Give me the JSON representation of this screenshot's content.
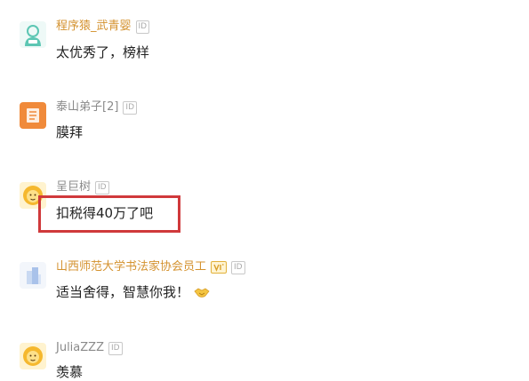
{
  "comments": [
    {
      "username": "程序猿_武青婴",
      "id_badge": "ID",
      "text": "太优秀了，榜样",
      "name_color": "#d4922f",
      "avatar_icon": "robot-icon",
      "avatar_color": "#5cc6b3"
    },
    {
      "username": "泰山弟子[2]",
      "id_badge": "ID",
      "text": "膜拜",
      "name_color": "#8a8a8a",
      "avatar_icon": "book-icon",
      "avatar_color": "#f08a3a"
    },
    {
      "username": "呈巨树",
      "id_badge": "ID",
      "text": "扣税得40万了吧",
      "name_color": "#8a8a8a",
      "avatar_icon": "lion-icon",
      "avatar_color": "#f5c23a"
    },
    {
      "username": "山西师范大学书法家协会员工",
      "id_badge": "ID",
      "text": "适当舍得，智慧你我！",
      "name_color": "#d4922f",
      "avatar_icon": "building-icon",
      "avatar_color": "#c9d9f2",
      "vip_badge": "vip-icon",
      "emoji": "handshake-icon"
    },
    {
      "username": "JuliaZZZ",
      "id_badge": "ID",
      "text": "羡慕",
      "name_color": "#8a8a8a",
      "avatar_icon": "lion-icon",
      "avatar_color": "#f5c23a"
    }
  ],
  "highlight_color": "#d0393b"
}
